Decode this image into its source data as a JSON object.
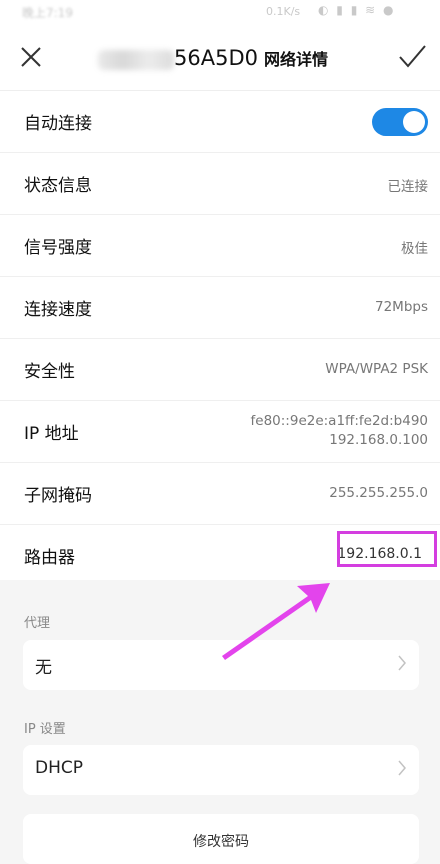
{
  "status_bar": {
    "time": "晚上7:19",
    "net_rate": "0.1K/s",
    "icons": "◐ ▮ ▮ ≋ ●"
  },
  "header": {
    "ssid": "56A5D0",
    "title": "网络详情"
  },
  "details": [
    {
      "label": "自动连接",
      "type": "toggle",
      "on": true
    },
    {
      "label": "状态信息",
      "value": "已连接"
    },
    {
      "label": "信号强度",
      "value": "极佳"
    },
    {
      "label": "连接速度",
      "value": "72Mbps"
    },
    {
      "label": "安全性",
      "value": "WPA/WPA2 PSK"
    },
    {
      "label": "IP 地址",
      "value_lines": [
        "fe80::9e2e:a1ff:fe2d:b490",
        "192.168.0.100"
      ]
    },
    {
      "label": "子网掩码",
      "value": "255.255.255.0"
    },
    {
      "label": "路由器",
      "value": "192.168.0.1"
    }
  ],
  "proxy": {
    "label": "代理",
    "value": "无"
  },
  "ip_settings": {
    "label": "IP 设置",
    "value": "DHCP"
  },
  "change_password": {
    "label": "修改密码"
  },
  "colors": {
    "accent": "#1e88e5",
    "highlight": "#d43ee0"
  }
}
